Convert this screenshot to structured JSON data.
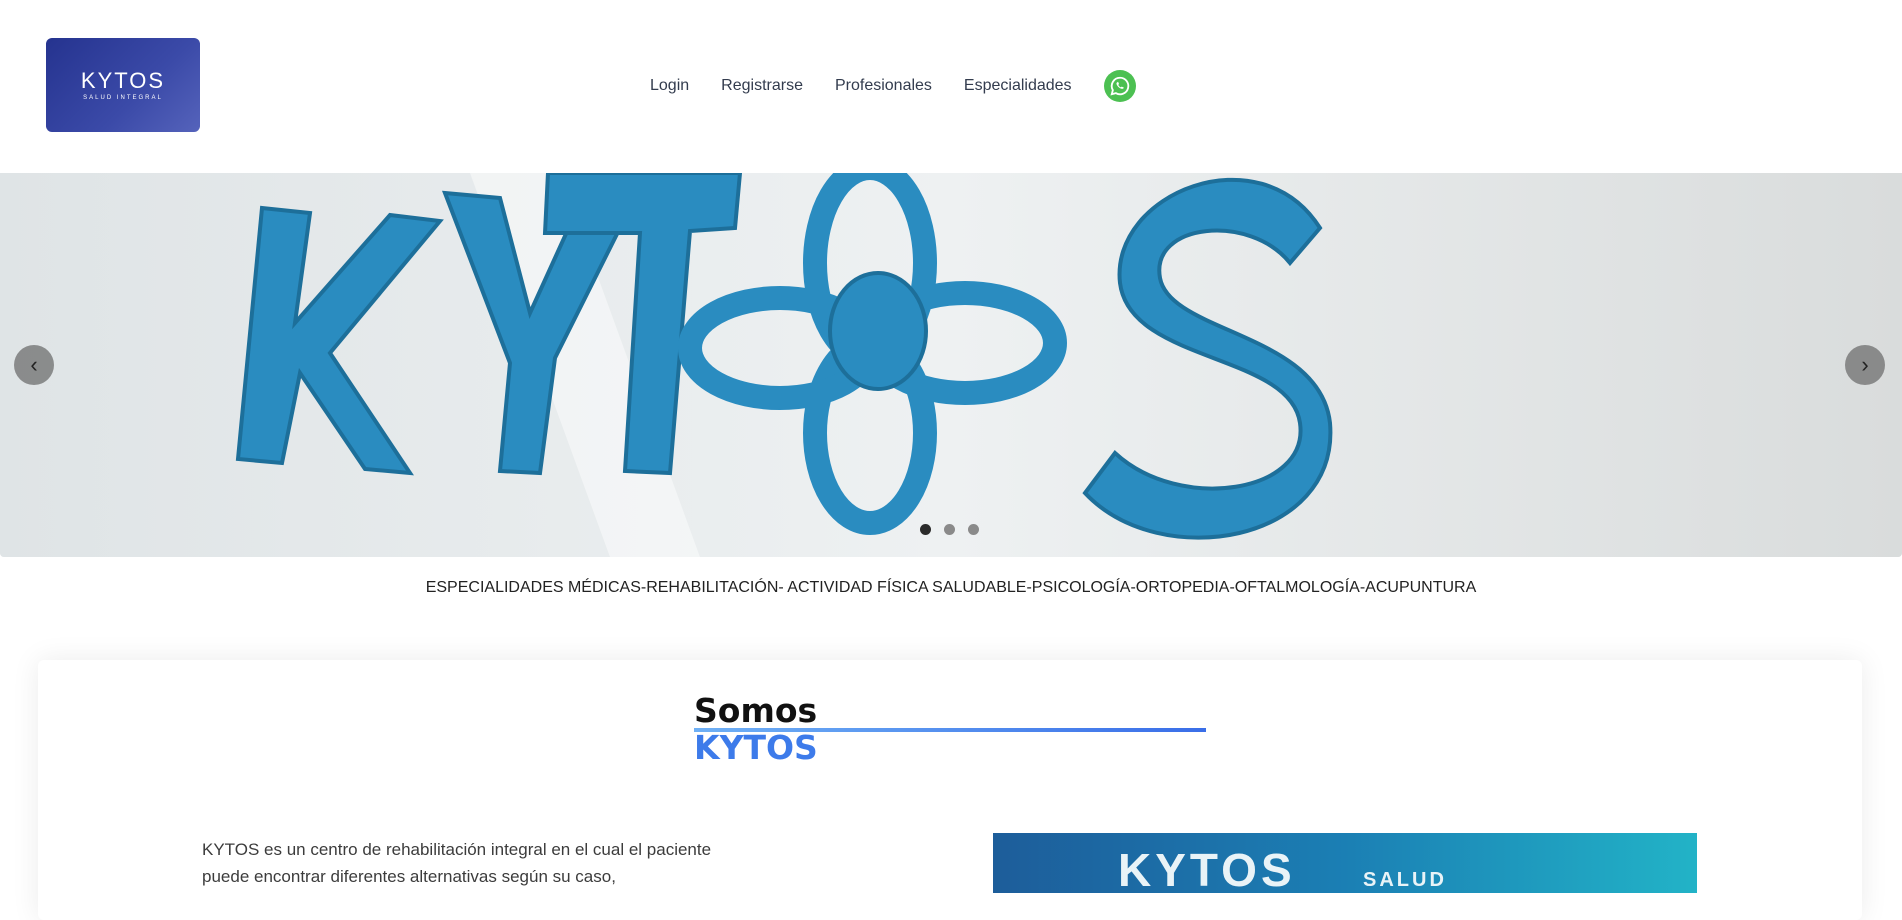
{
  "header": {
    "logo_text": "KYTOS",
    "logo_subtext": "SALUD INTEGRAL",
    "nav": {
      "login": "Login",
      "register": "Registrarse",
      "professionals": "Profesionales",
      "specialties": "Especialidades"
    },
    "whatsapp_icon": "whatsapp-icon"
  },
  "carousel": {
    "slide_text": "KYTOS",
    "prev_icon": "chevron-left-icon",
    "next_icon": "chevron-right-icon",
    "slides_count": 3,
    "active_slide": 1
  },
  "tagline": "ESPECIALIDADES MÉDICAS-REHABILITACIÓN- ACTIVIDAD FÍSICA SALUDABLE-PSICOLOGÍA-ORTOPEDIA-OFTALMOLOGÍA-ACUPUNTURA",
  "about": {
    "heading_line1": "Somos",
    "heading_line2": "KYTOS",
    "paragraph": "KYTOS es un centro de rehabilitación integral en el cual el paciente puede encontrar diferentes alternativas según su caso,",
    "photo_text": "KYTOS",
    "photo_subtext": "SALUD"
  },
  "colors": {
    "brand_blue": "#2f3d99",
    "accent_blue": "#3d7bea",
    "logo_letter_blue": "#2a8cc0",
    "whatsapp_green": "#4cc052"
  }
}
